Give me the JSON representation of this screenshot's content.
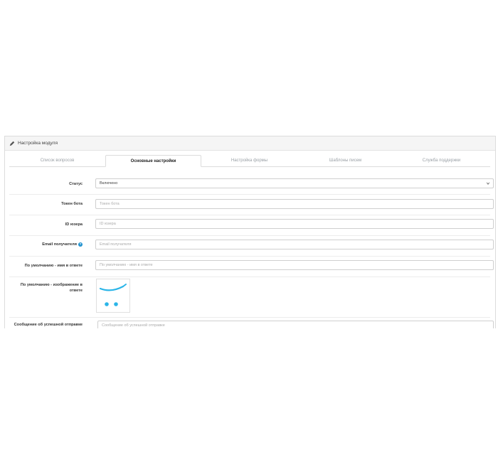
{
  "panel": {
    "title": "Настройка модуля"
  },
  "tabs": [
    {
      "label": "Список вопросов",
      "active": false
    },
    {
      "label": "Основные настройки",
      "active": true
    },
    {
      "label": "Настройка формы",
      "active": false
    },
    {
      "label": "Шаблоны писем",
      "active": false
    },
    {
      "label": "Служба поддержки",
      "active": false
    }
  ],
  "form": {
    "status": {
      "label": "Статус",
      "value": "Включено"
    },
    "bot_token": {
      "label": "Токен бота",
      "placeholder": "Токен бота"
    },
    "user_id": {
      "label": "ID юзера",
      "placeholder": "ID юзера"
    },
    "email": {
      "label": "Email получателя",
      "placeholder": "Email получателя"
    },
    "default_name": {
      "label": "По умолчанию - имя в ответе",
      "placeholder": "По умолчанию - имя в ответе"
    },
    "default_image": {
      "label": "По умолчанию - изображение в ответе"
    },
    "new_question_message": {
      "label": "Сообщение об успешной отправке",
      "placeholder": "Сообщение об успешной отправке"
    }
  },
  "colors": {
    "accent": "#1e91cf",
    "logo": "#2bb5e8"
  },
  "icons": {
    "heading": "pencil-icon",
    "help": "help-icon",
    "select": "chevron-down-icon",
    "image": "cart-logo-icon"
  }
}
